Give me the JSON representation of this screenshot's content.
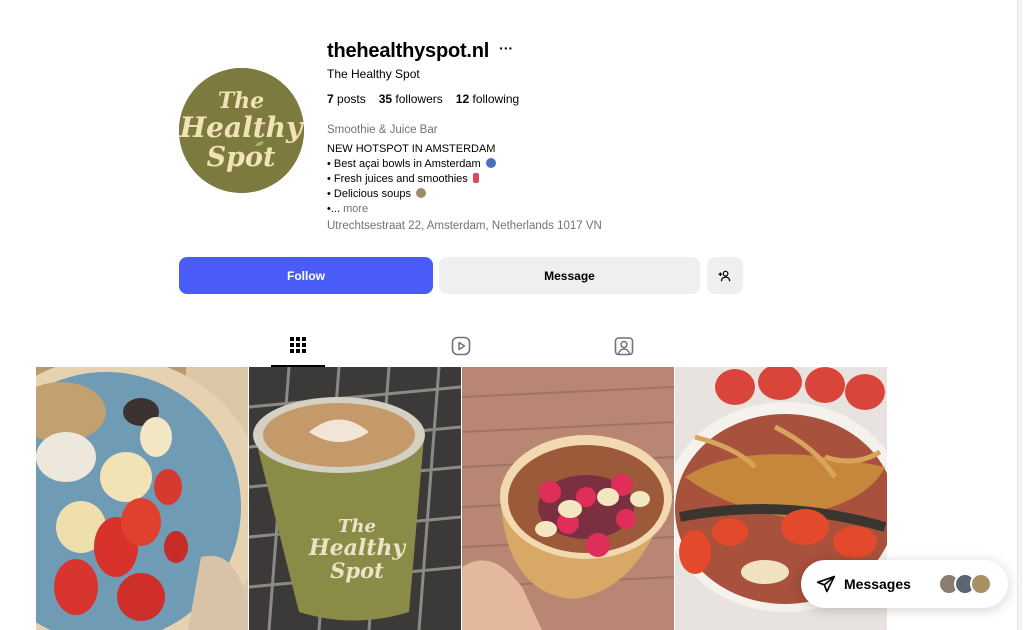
{
  "profile": {
    "username": "thehealthyspot.nl",
    "more_options": "···",
    "full_name": "The Healthy Spot",
    "stats": {
      "posts_count": "7",
      "posts_label": "posts",
      "followers_count": "35",
      "followers_label": "followers",
      "following_count": "12",
      "following_label": "following"
    },
    "category": "Smoothie & Juice Bar",
    "bio": {
      "line1": "NEW HOTSPOT IN AMSTERDAM",
      "line2": "• Best açai bowls in Amsterdam",
      "line3": "• Fresh juices and smoothies",
      "line4": "• Delicious soups",
      "line5": "•...",
      "more": "more"
    },
    "address": "Utrechtsestraat 22, Amsterdam, Netherlands 1017 VN",
    "avatar_logo_lines": [
      "The",
      "Healthy",
      "Spot"
    ]
  },
  "actions": {
    "follow_label": "Follow",
    "message_label": "Message",
    "add_user_icon": "person-plus-icon"
  },
  "tabs": [
    {
      "name": "posts",
      "icon": "grid-icon",
      "active": true
    },
    {
      "name": "reels",
      "icon": "reels-icon",
      "active": false
    },
    {
      "name": "tagged",
      "icon": "tagged-icon",
      "active": false
    }
  ],
  "posts": [
    {
      "subject": "blue smoothie bowl with banana and strawberry"
    },
    {
      "subject": "latte in The Healthy Spot cup",
      "cup_text": [
        "The",
        "Healthy",
        "Spot"
      ]
    },
    {
      "subject": "acai bowl with raspberries"
    },
    {
      "subject": "smoothie bowl with peanut butter and chia"
    }
  ],
  "messages": {
    "label": "Messages",
    "icon": "send-icon"
  },
  "colors": {
    "follow_button": "#4a5cf7",
    "secondary_button": "#efeff1",
    "avatar_bg": "#7c7a3f",
    "logo_text": "#f1e3b6",
    "muted_text": "#737373"
  }
}
